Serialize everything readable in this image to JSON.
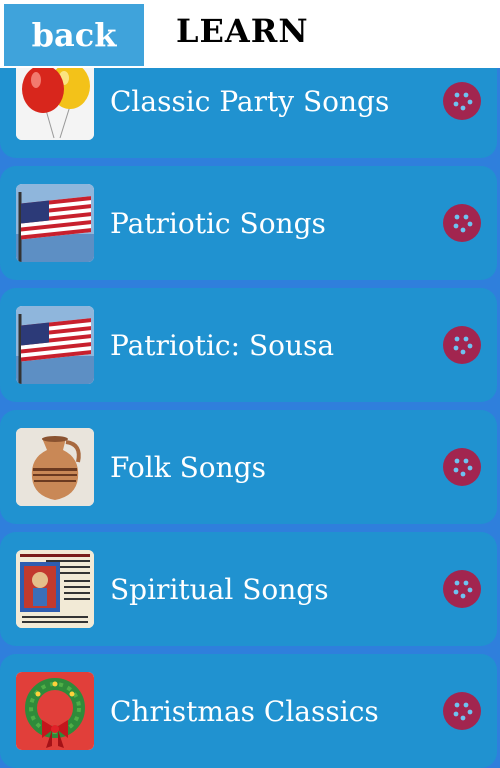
{
  "header": {
    "back_label": "back",
    "title": "LEARN"
  },
  "colors": {
    "background": "#2f7fdc",
    "row": "#2092d0",
    "back_button": "#3fa3db",
    "row_button": "#a2254f",
    "row_button_dots": "#6fc3f0"
  },
  "items": [
    {
      "label": "Classic Party Songs",
      "icon": "balloons-icon"
    },
    {
      "label": "Patriotic Songs",
      "icon": "us-flag-icon"
    },
    {
      "label": "Patriotic: Sousa",
      "icon": "us-flag-icon"
    },
    {
      "label": "Folk Songs",
      "icon": "pottery-jug-icon"
    },
    {
      "label": "Spiritual Songs",
      "icon": "illuminated-manuscript-icon"
    },
    {
      "label": "Christmas Classics",
      "icon": "wreath-icon"
    }
  ],
  "row_button_icon": "more-options-icon"
}
